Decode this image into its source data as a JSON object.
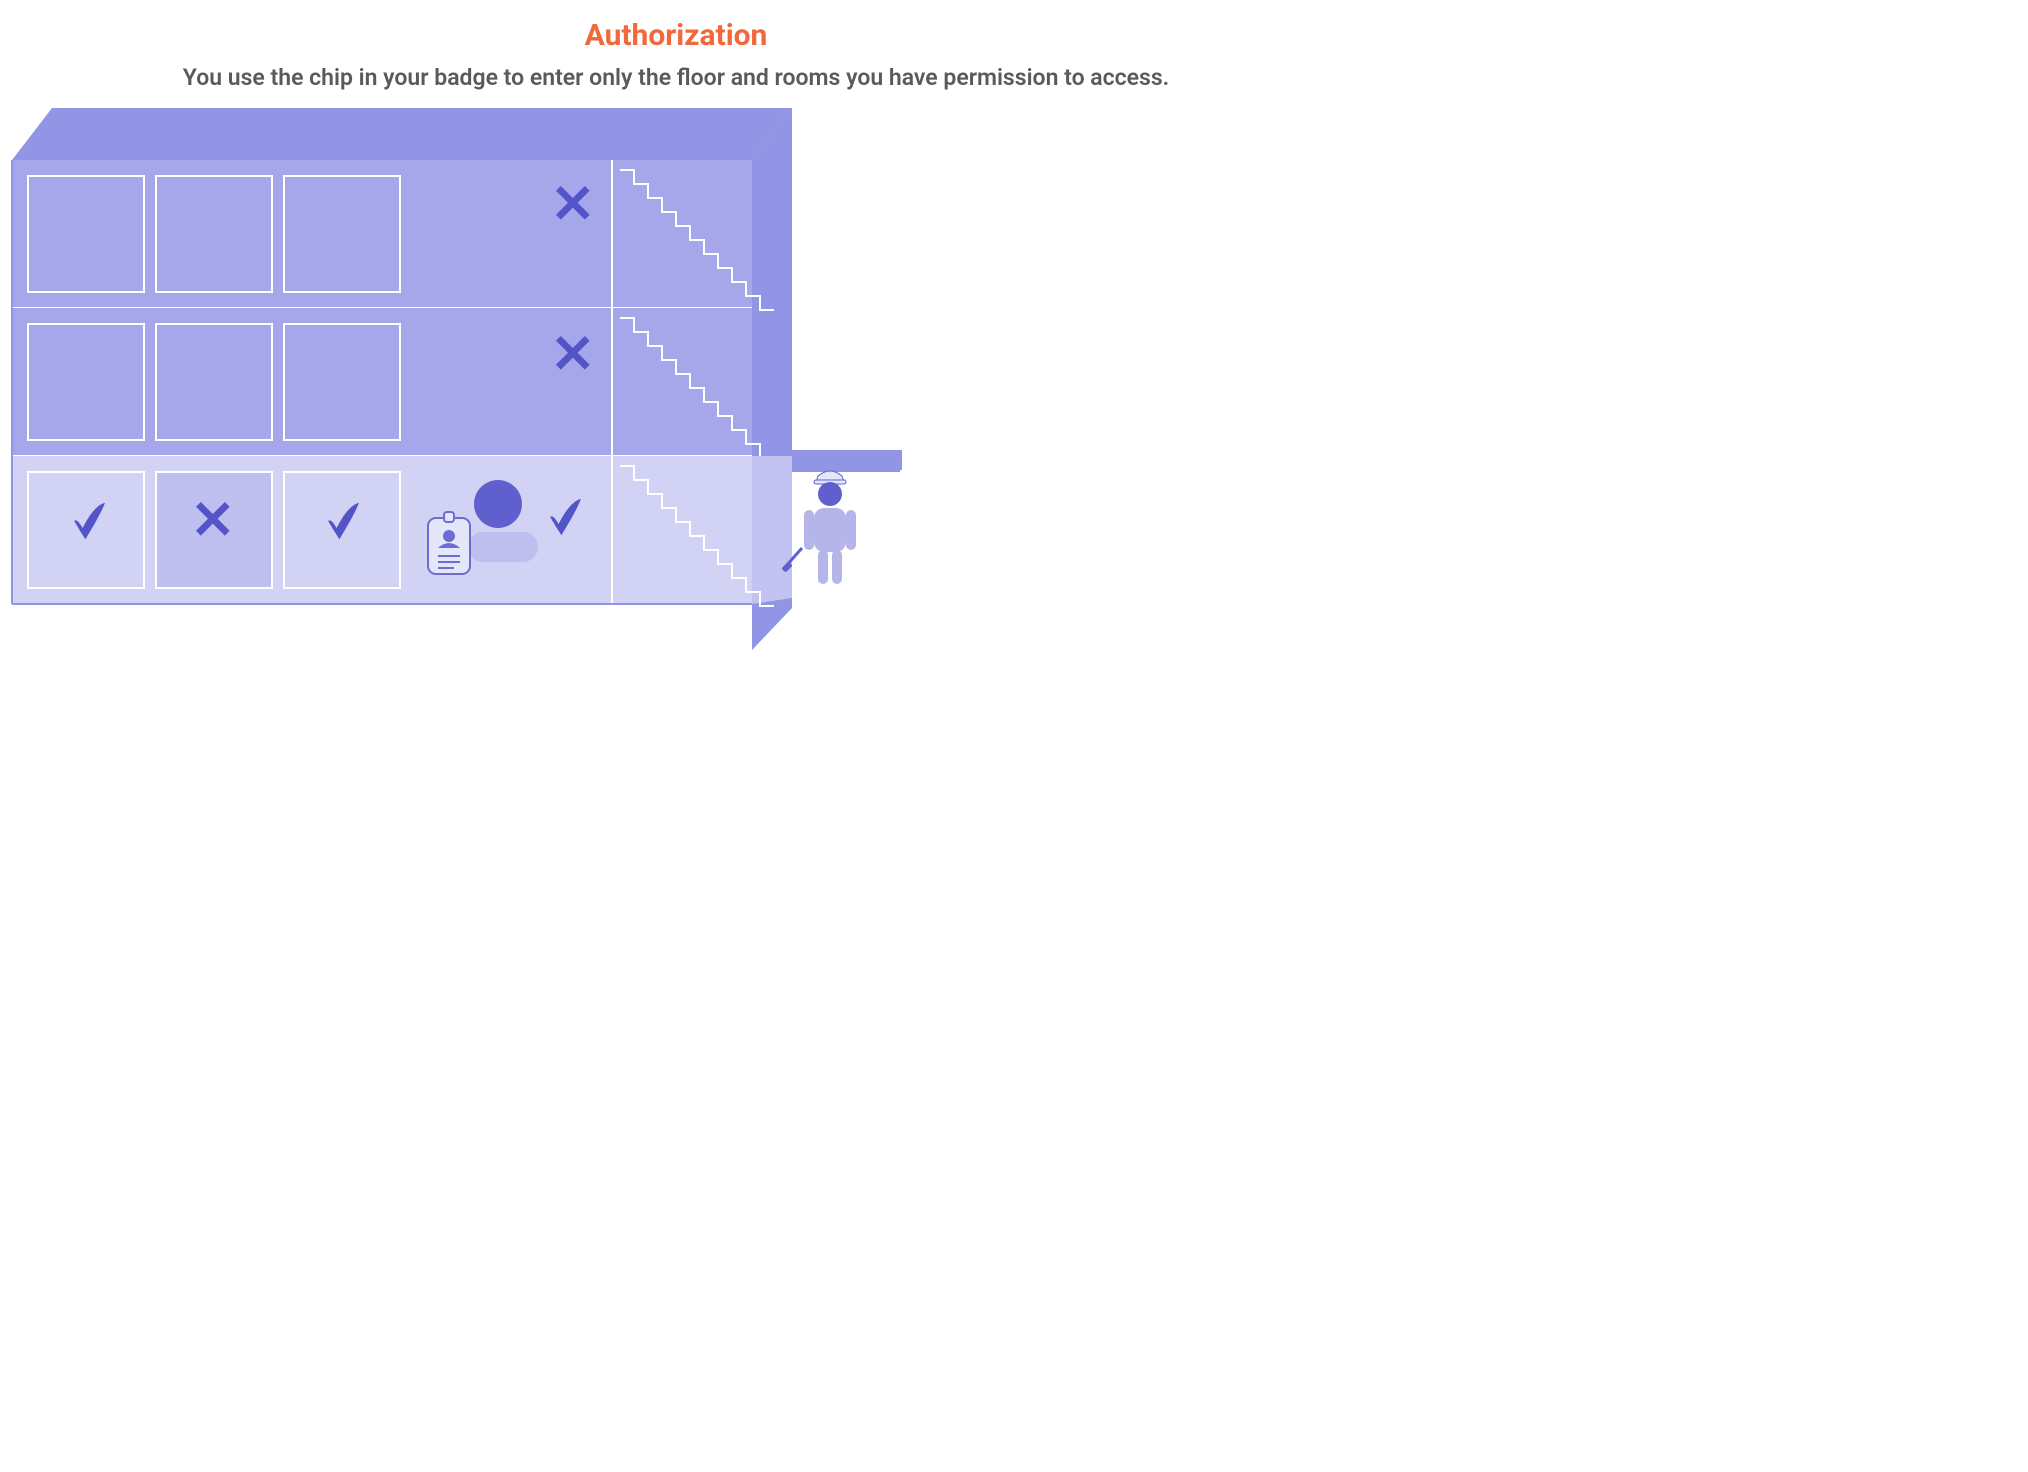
{
  "title": "Authorization",
  "subtitle": "You use the chip in your badge to enter only the floor and rooms you have permission to access.",
  "colors": {
    "title": "#F2683B",
    "subtitle": "#5A5A5A",
    "building_roof": "#9294E5",
    "building_side": "#9294E5",
    "floor_upper": "#A6A6EA",
    "floor_ground": "#D1D2F4",
    "room_line": "#FFFFFF",
    "room_denied_fill": "#BEBEEF",
    "mark": "#5254C8",
    "person": "#5254C8",
    "badge_fill": "#E6E6FB",
    "badge_stroke": "#6B6DD3",
    "guard_body": "#B6B5EA",
    "guard_face": "#5F60CE"
  },
  "floors": [
    {
      "id": 3,
      "accessible": false,
      "rooms": [
        {
          "id": "3a",
          "status": "none"
        },
        {
          "id": "3b",
          "status": "none"
        },
        {
          "id": "3c",
          "status": "none"
        }
      ],
      "floor_mark": "deny"
    },
    {
      "id": 2,
      "accessible": false,
      "rooms": [
        {
          "id": "2a",
          "status": "none"
        },
        {
          "id": "2b",
          "status": "none"
        },
        {
          "id": "2c",
          "status": "none"
        }
      ],
      "floor_mark": "deny"
    },
    {
      "id": 1,
      "accessible": true,
      "rooms": [
        {
          "id": "1a",
          "status": "allow"
        },
        {
          "id": "1b",
          "status": "deny"
        },
        {
          "id": "1c",
          "status": "allow"
        }
      ],
      "floor_mark": "allow"
    }
  ],
  "icons": {
    "allow": "check-icon",
    "deny": "x-icon",
    "stairs": "stairs-icon",
    "badge": "badge-icon",
    "person": "person-icon",
    "guard": "guard-icon"
  }
}
